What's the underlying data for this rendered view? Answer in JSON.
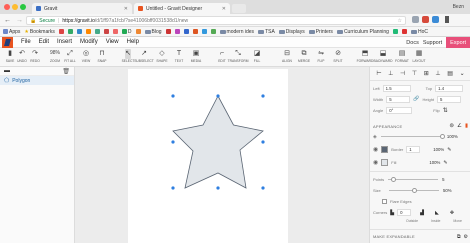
{
  "browser": {
    "user": "Bezn",
    "tabs": [
      {
        "label": "Gravit",
        "favicon_color": "#3b6fc4"
      },
      {
        "label": "Untitled - Gravit Designer",
        "favicon_color": "#e8531f"
      }
    ],
    "secure_label": "Secure",
    "url_host": "https://gravit.io",
    "url_path": "/d/1ff97a1fcb/?se41006bff0031538d1/new",
    "bookmarks": [
      {
        "label": "Apps"
      },
      {
        "label": "Bookmarks"
      },
      {
        "label": "D"
      },
      {
        "label": "Blog"
      },
      {
        "label": "modern ides"
      },
      {
        "label": "TSA"
      },
      {
        "label": "Displays"
      },
      {
        "label": "Printers"
      },
      {
        "label": "Curriculum Planning"
      },
      {
        "label": "HoC"
      }
    ]
  },
  "menu": {
    "items": [
      "File",
      "Edit",
      "Insert",
      "Modify",
      "View",
      "Help"
    ],
    "docs_label": "Docs",
    "support_label": "Support",
    "export_label": "Export"
  },
  "toolbar": {
    "tools": [
      {
        "label": "SAVE",
        "icon": "▮"
      },
      {
        "label": "UNDO",
        "icon": "↶"
      },
      {
        "label": "REDO",
        "icon": "↷"
      },
      {
        "label": "ZOOM",
        "icon": "98%"
      },
      {
        "label": "FIT ALL",
        "icon": "⤢"
      },
      {
        "label": "VIEW",
        "icon": "◎"
      },
      {
        "label": "SNAP",
        "icon": "⊓"
      },
      {
        "label": "SELECT",
        "icon": "↖"
      },
      {
        "label": "SUBSELECT",
        "icon": "↗"
      },
      {
        "label": "SHAPE",
        "icon": "◇"
      },
      {
        "label": "TEXT",
        "icon": "T"
      },
      {
        "label": "MEDIA",
        "icon": "▣"
      },
      {
        "label": "EDIT",
        "icon": "⌐"
      },
      {
        "label": "TRANSFORM",
        "icon": "⤡"
      },
      {
        "label": "FILL",
        "icon": "◪"
      },
      {
        "label": "ALIGN",
        "icon": "⊟"
      },
      {
        "label": "MERGE",
        "icon": "⧉"
      },
      {
        "label": "FLIP",
        "icon": "⇋"
      },
      {
        "label": "SPLIT",
        "icon": "⊘"
      },
      {
        "label": "FORWARD",
        "icon": "⬒"
      },
      {
        "label": "BACKWARD",
        "icon": "⬓"
      },
      {
        "label": "FORMAT",
        "icon": "▤"
      },
      {
        "label": "LAYOUT",
        "icon": "▦"
      }
    ]
  },
  "layers": {
    "items": [
      {
        "label": "Polygon",
        "selected": true
      }
    ]
  },
  "inspector": {
    "left_label": "Left",
    "left_value": "1.5",
    "top_label": "Top",
    "top_value": "1.4",
    "width_label": "Width",
    "width_value": "5",
    "height_label": "Height",
    "height_value": "5",
    "angle_label": "Angle",
    "angle_value": "0°",
    "flip_label": "Flip",
    "appearance_label": "APPEARANCE",
    "opacity_value": "100%",
    "border_label": "Border",
    "border_value": "1",
    "border_opacity": "100%",
    "fill_label": "Fill",
    "fill_opacity": "100%",
    "points_label": "Points",
    "points_value": "5",
    "size_label": "Size",
    "size_value": "50%",
    "flare_label": "Flare Edges",
    "corners_label": "Corners",
    "corners_value": "0",
    "outside_label": "Outside",
    "inside_label": "Inside",
    "move_label": "Move",
    "make_label": "MAKE EXPANDABLE",
    "fill_color": "#e2e6ea",
    "stroke_color": "#5a6573"
  }
}
